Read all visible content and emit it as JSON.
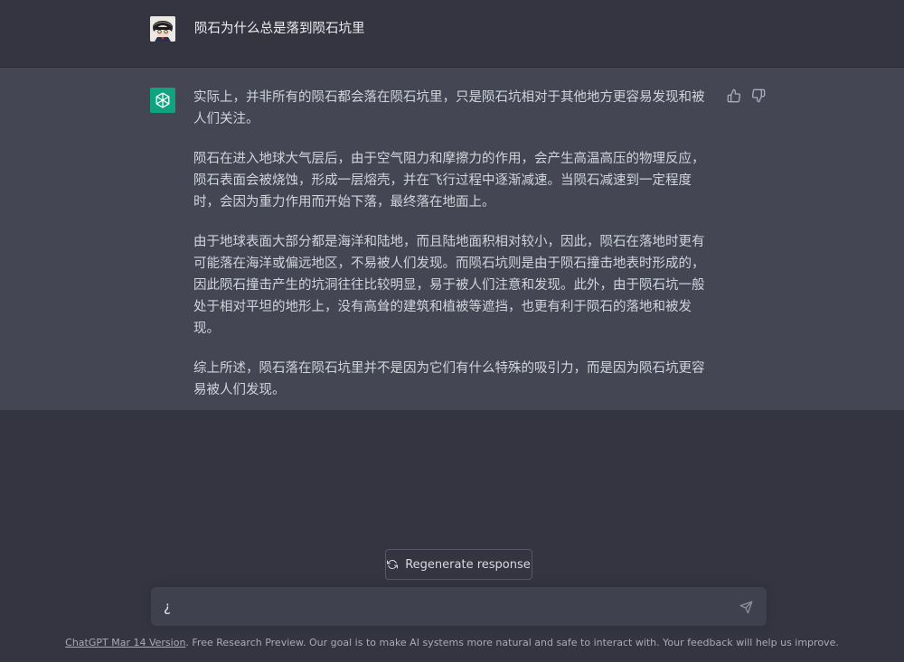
{
  "user_message": {
    "text": "陨石为什么总是落到陨石坑里",
    "avatar": "user-avatar-photo"
  },
  "assistant_message": {
    "avatar": "openai-logo-icon",
    "paragraphs": [
      "实际上，并非所有的陨石都会落在陨石坑里，只是陨石坑相对于其他地方更容易发现和被人们关注。",
      "陨石在进入地球大气层后，由于空气阻力和摩擦力的作用，会产生高温高压的物理反应，陨石表面会被烧蚀，形成一层熔壳，并在飞行过程中逐渐减速。当陨石减速到一定程度时，会因为重力作用而开始下落，最终落在地面上。",
      "由于地球表面大部分都是海洋和陆地，而且陆地面积相对较小，因此，陨石在落地时更有可能落在海洋或偏远地区，不易被人们发现。而陨石坑则是由于陨石撞击地表时形成的，因此陨石撞击产生的坑洞往往比较明显，易于被人们注意和发现。此外，由于陨石坑一般处于相对平坦的地形上，没有高耸的建筑和植被等遮挡，也更有利于陨石的落地和被发现。",
      "综上所述，陨石落在陨石坑里并不是因为它们有什么特殊的吸引力，而是因为陨石坑更容易被人们发现。"
    ],
    "feedback_icons": [
      "thumbs-up-icon",
      "thumbs-down-icon"
    ]
  },
  "regenerate": {
    "label": "Regenerate response",
    "icon": "refresh-icon"
  },
  "composer": {
    "value": "¿",
    "send_icon": "send-icon"
  },
  "footer": {
    "link_text": "ChatGPT Mar 14 Version",
    "text": ". Free Research Preview. Our goal is to make AI systems more natural and safe to interact with. Your feedback will help us improve."
  },
  "colors": {
    "background": "#343541",
    "assistant_background": "#444654",
    "accent": "#10a37f",
    "input_background": "#40414f"
  }
}
